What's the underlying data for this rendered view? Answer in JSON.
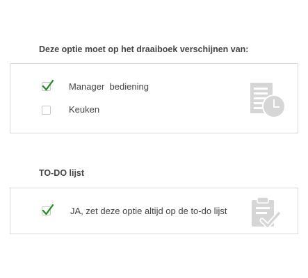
{
  "script_section": {
    "title": "Deze optie moet op het draaiboek verschijnen van:",
    "options": [
      {
        "label": "Manager  bediening",
        "checked": true
      },
      {
        "label": "Keuken",
        "checked": false
      }
    ],
    "icon": "document-clock-icon"
  },
  "todo_section": {
    "title": "TO-DO lijst",
    "options": [
      {
        "label": "JA, zet deze optie altijd op de to-do lijst",
        "checked": true
      }
    ],
    "icon": "clipboard-check-icon"
  },
  "colors": {
    "checkmark": "#1f8a1f",
    "icon_gray": "#d2d2d2",
    "border": "#d9d9d9"
  }
}
